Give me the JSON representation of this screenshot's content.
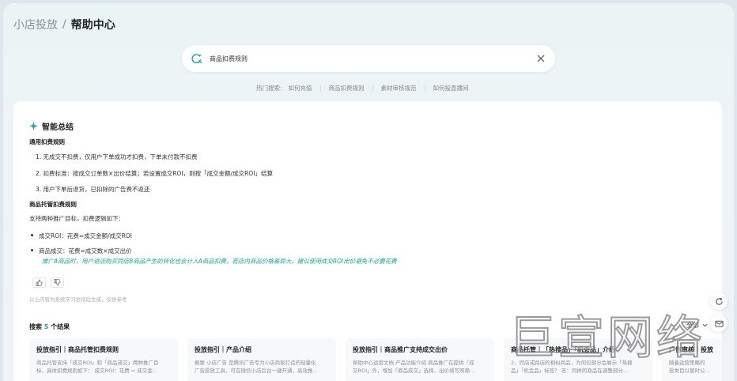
{
  "breadcrumb": {
    "root": "小店投放",
    "separator": "/",
    "current": "帮助中心"
  },
  "search": {
    "value": "商品扣费规则"
  },
  "hot_searches": {
    "label": "热门搜索:",
    "items": [
      "如何充值",
      "商品扣费规则",
      "素材审核规范",
      "如何投直播间"
    ]
  },
  "ai_summary": {
    "title": "智能总结",
    "section1_title": "通用扣费规则",
    "section1_items": [
      "1. 无成交不扣费，仅用户下单成功才扣费，下单未付款不扣费",
      "2. 扣费标准：按成交订单数×出价结算；若设置成交ROI，则按「成交金额/成交ROI」结算",
      "3. 用户下单后退货，已扣除的广告费不返还"
    ],
    "section2_title": "商品托管扣费规则",
    "section2_intro": "支持两种推广目标，扣费逻辑如下：",
    "section2_bullets": [
      "成交ROI：花费=成交金额/成交ROI",
      "商品成交：花费=成交数×成交出价"
    ],
    "note": "推广A商品时，用户进店购买同店B商品产生的转化也会计入A商品扣费，若店内商品价格差异大，建议使用成交ROI出价避免不必要花费",
    "disclaimer": "以上内容为系统学习总结后生成，仅供参考"
  },
  "results": {
    "prefix": "搜索",
    "count": "5",
    "suffix": "个结果",
    "filter_label": "全部",
    "cards": [
      {
        "title": "投放指引｜商品托管扣费规则",
        "line1": "商品托管支持「成交ROI」和「商品成交」两种推广目",
        "line2": "标，具体扣费规则如下： 成交ROI：花费 = 成交金..."
      },
      {
        "title": "投放指引｜产品介绍",
        "line1": "概要 小店广告 是腾讯广告专为小店商家打造的轻量化",
        "line2": "广告投放工具，可在微信小店后台一键开通，高效推..."
      },
      {
        "title": "投放指引｜商品推广支持成交出价",
        "line1": "帮助中心运营文档 产品功能介绍 商品推广在提供「成",
        "line2": "交ROI」外，增加「商品成交」选择，出价填写照赖..."
      },
      {
        "title": "商品托管｜「热搜品」「机会品」介绍",
        "line1": "2、同店或跨店的相似商品，为何仅部分会展示「热搜",
        "line2": "品」「机会品」标签？ 答：同样的商品在调整部分..."
      },
      {
        "title": "广告审核｜投放",
        "line1": "随着运营策略的",
        "line2": "投类目以届时公..."
      }
    ]
  },
  "watermark": "巨宣网络",
  "colors": {
    "accent": "#17a3a0",
    "card_bg": "#ffffff",
    "result_bg": "#f6f8fa"
  }
}
